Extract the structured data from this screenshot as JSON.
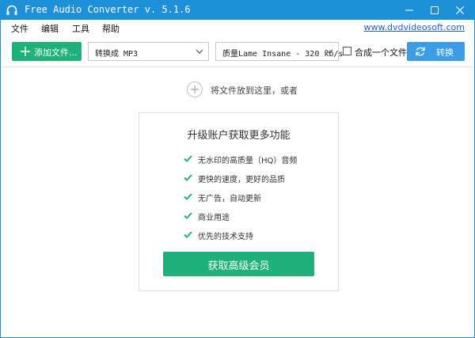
{
  "window": {
    "title": "Free Audio Converter v. 5.1.6",
    "accent_color": "#1e90d8",
    "icons": {
      "app": "headphones-icon",
      "minimize": "minimize-icon",
      "maximize": "maximize-icon",
      "close": "close-icon"
    }
  },
  "menu": {
    "items": [
      "文件",
      "编辑",
      "工具",
      "帮助"
    ],
    "site_link": "www.dvdvideosoft.com"
  },
  "toolbar": {
    "add_label": "添加文件...",
    "add_color": "#1eb27a",
    "format_value": "转换成 MP3",
    "quality_value": "质量Lame Insane - 320 kb/s",
    "merge_label": "合成一个文件",
    "merge_checked": false,
    "convert_label": "转换",
    "convert_color": "#3a9de6"
  },
  "main": {
    "drop_text": "将文件放到这里，或者",
    "promo": {
      "title": "升级账户获取更多功能",
      "features": [
        "无水印的高质量（HQ）音频",
        "更快的速度，更好的品质",
        "无广告，自动更新",
        "商业用途",
        "优先的技术支持"
      ],
      "check_color": "#1eb27a",
      "button_label": "获取高级会员"
    }
  }
}
